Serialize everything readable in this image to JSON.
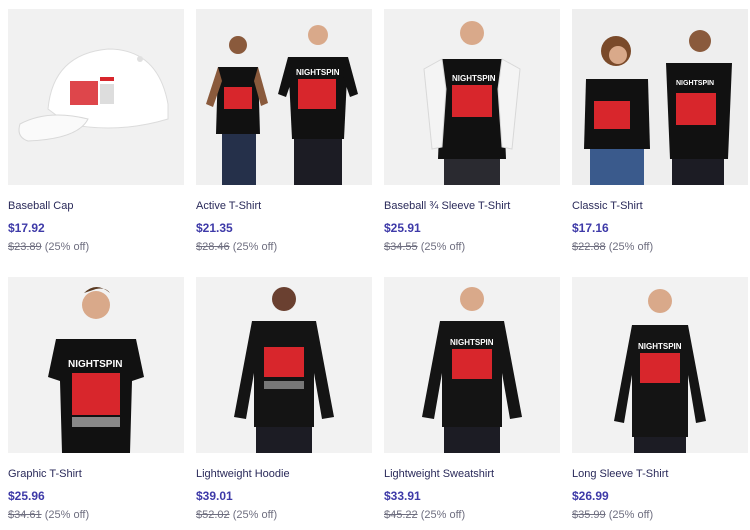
{
  "products": [
    {
      "title": "Baseball Cap",
      "price": "$17.92",
      "original_price": "$23.89",
      "discount": "(25% off)",
      "image": "cap"
    },
    {
      "title": "Active T-Shirt",
      "price": "$21.35",
      "original_price": "$28.46",
      "discount": "(25% off)",
      "image": "two-models-tee"
    },
    {
      "title": "Baseball ¾ Sleeve T-Shirt",
      "price": "$25.91",
      "original_price": "$34.55",
      "discount": "(25% off)",
      "image": "raglan"
    },
    {
      "title": "Classic T-Shirt",
      "price": "$17.16",
      "original_price": "$22.88",
      "discount": "(25% off)",
      "image": "two-models-tee"
    },
    {
      "title": "Graphic T-Shirt",
      "price": "$25.96",
      "original_price": "$34.61",
      "discount": "(25% off)",
      "image": "tee"
    },
    {
      "title": "Lightweight Hoodie",
      "price": "$39.01",
      "original_price": "$52.02",
      "discount": "(25% off)",
      "image": "hoodie"
    },
    {
      "title": "Lightweight Sweatshirt",
      "price": "$33.91",
      "original_price": "$45.22",
      "discount": "(25% off)",
      "image": "sweatshirt"
    },
    {
      "title": "Long Sleeve T-Shirt",
      "price": "$26.99",
      "original_price": "$35.99",
      "discount": "(25% off)",
      "image": "longsleeve"
    }
  ],
  "print_text": "NIGHTSPIN",
  "colors": {
    "price": "#3e3aa8",
    "title": "#2a2a5a",
    "muted": "#6f6f80",
    "thumb_bg": "#efefef",
    "garment": "#111111",
    "print_red": "#d8262c"
  }
}
